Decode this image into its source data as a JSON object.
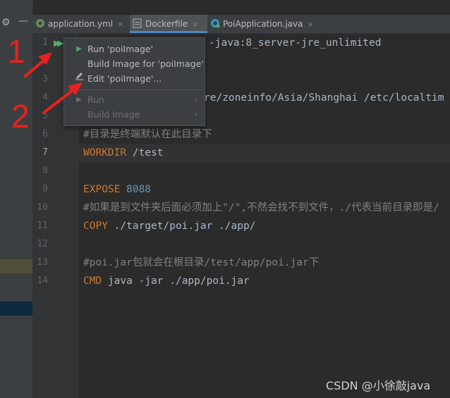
{
  "tabs": [
    {
      "label": "application.yml",
      "icon": "yaml-file-icon",
      "close": "×"
    },
    {
      "label": "Dockerfile",
      "icon": "docker-file-icon",
      "close": "×"
    },
    {
      "label": "PoiApplication.java",
      "icon": "java-class-icon",
      "close": "×"
    }
  ],
  "editor": {
    "line_numbers": [
      "1",
      "2",
      "3",
      "4",
      "5",
      "6",
      "7",
      "8",
      "9",
      "10",
      "11",
      "12",
      "13",
      "14"
    ],
    "lines": {
      "l1_rest": "-java:8_server-jre_unlimited",
      "l4_rest": "re/zoneinfo/Asia/Shanghai /etc/localtim",
      "l6_comment": "#目录是终端默认在此目录下",
      "l7_kw": "WORKDIR",
      "l7_arg": " /test",
      "l9_kw": "EXPOSE",
      "l9_num": " 8088",
      "l10_comment": "#如果是到文件夹后面必须加上\"/\",不然会找不到文件，./代表当前目录即是/",
      "l11_kw": "COPY",
      "l11_arg": " ./target/poi.jar ./app/",
      "l13_comment": "#poi.jar包就会在根目录/test/app/poi.jar下",
      "l14_kw": "CMD",
      "l14_arg": " java -jar ./app/poi.jar"
    }
  },
  "popup_menu": {
    "items": [
      {
        "label": "Run 'poiImage'",
        "icon": "run-triangle-icon",
        "enabled": true
      },
      {
        "label": "Build Image for 'poiImage'",
        "icon": "",
        "enabled": true
      },
      {
        "label": "Edit 'poiImage'...",
        "icon": "edit-pencil-icon",
        "enabled": true
      },
      {
        "label": "Run",
        "icon": "run-icon",
        "enabled": false,
        "submenu": "›"
      },
      {
        "label": "Build Image",
        "icon": "",
        "enabled": false,
        "submenu": "›"
      }
    ]
  },
  "annotations": {
    "num1": "1",
    "num2": "2"
  },
  "watermark": "CSDN @小徐敲java",
  "colors": {
    "accent_red": "#e8221c",
    "keyword": "#cc7832",
    "number": "#6897bb",
    "comment": "#808080",
    "tab_underline": "#4a88c7"
  }
}
